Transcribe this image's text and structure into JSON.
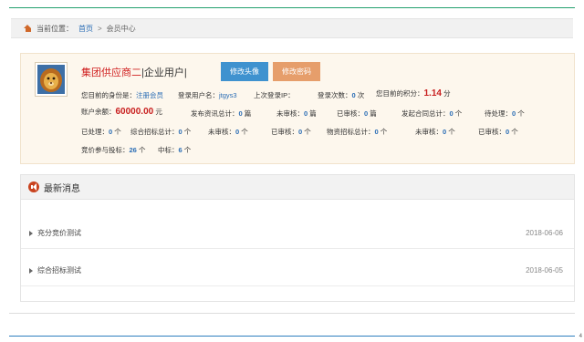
{
  "breadcrumb": {
    "prefix": "当前位置：",
    "home": "首页",
    "separator": ">",
    "current": "会员中心"
  },
  "user": {
    "company_name": "集团供应商二",
    "user_type": "|企业用户|",
    "buttons": {
      "change_avatar": "修改头像",
      "change_password": "修改密码"
    },
    "identity_label": "您目前的身份是：",
    "identity_value": "注册会员",
    "login_name_label": "登录用户名：",
    "login_name_value": "jtgys3",
    "last_login_label": "上次登录IP：",
    "last_login_value": "",
    "login_count_label": "登录次数：",
    "login_count_value": "0",
    "login_count_unit": "次",
    "points_label": "您目前的积分：",
    "points_value": "1.14",
    "points_unit": "分",
    "balance_label": "账户余额：",
    "balance_value": "60000.00",
    "balance_unit": "元",
    "stats_row1": [
      {
        "label": "发布资讯总计：",
        "value": "0",
        "unit": "篇"
      },
      {
        "label": "未审核：",
        "value": "0",
        "unit": "篇"
      },
      {
        "label": "已审核：",
        "value": "0",
        "unit": "篇"
      },
      {
        "label": "发起合同总计：",
        "value": "0",
        "unit": "个"
      },
      {
        "label": "待处理：",
        "value": "0",
        "unit": "个"
      }
    ],
    "stats_row2": [
      {
        "label": "已处理：",
        "value": "0",
        "unit": "个"
      },
      {
        "label": "综合招标总计：",
        "value": "0",
        "unit": "个"
      },
      {
        "label": "未审核：",
        "value": "0",
        "unit": "个"
      },
      {
        "label": "已审核：",
        "value": "0",
        "unit": "个"
      },
      {
        "label": "物资招标总计：",
        "value": "0",
        "unit": "个"
      },
      {
        "label": "未审核：",
        "value": "0",
        "unit": "个"
      },
      {
        "label": "已审核：",
        "value": "0",
        "unit": "个"
      }
    ],
    "stats_row3": [
      {
        "label": "竞价参与投标：",
        "value": "26",
        "unit": "个"
      },
      {
        "label": "中标：",
        "value": "6",
        "unit": "个"
      }
    ]
  },
  "news": {
    "title": "最新消息",
    "items": [
      {
        "title": "充分竞价测试",
        "date": "2018-06-06"
      },
      {
        "title": "综合招标测试",
        "date": "2018-06-05"
      }
    ]
  },
  "footer": {
    "corner": "4"
  },
  "colors": {
    "accent_green": "#23a06e",
    "brand_red": "#d02020",
    "button_blue": "#3f92cf",
    "button_orange": "#e69e6b",
    "panel_bg": "#fdf7ed"
  }
}
